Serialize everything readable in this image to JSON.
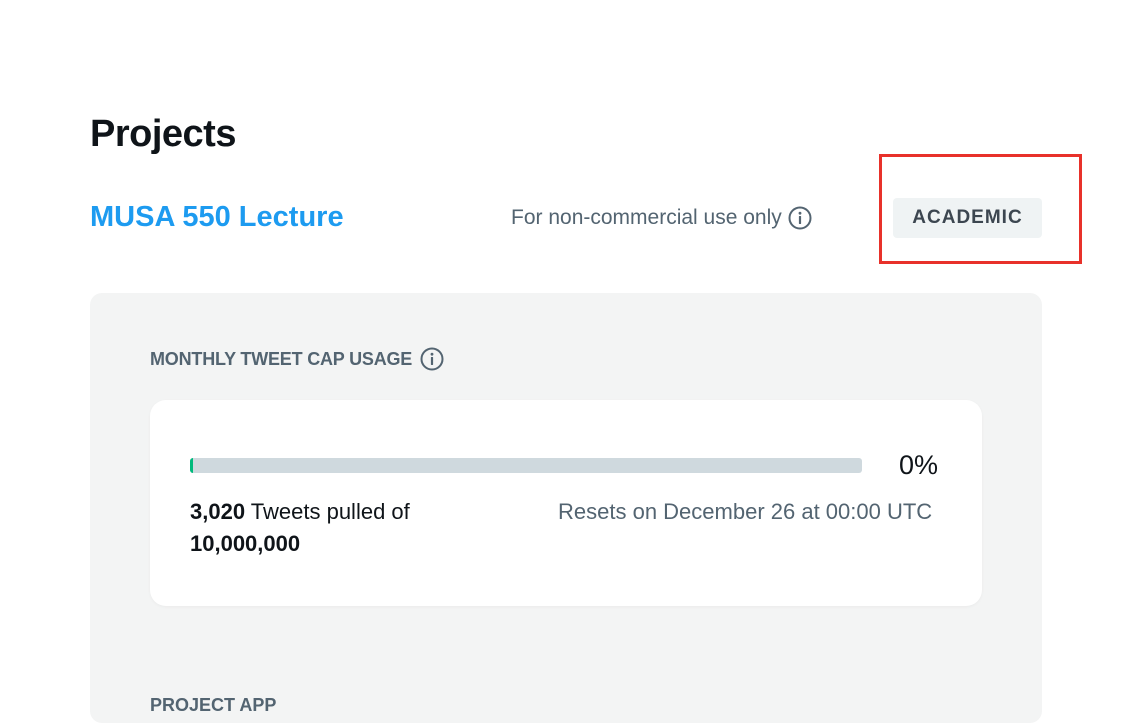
{
  "page": {
    "title": "Projects"
  },
  "project": {
    "name": "MUSA 550 Lecture",
    "usage_note": "For non-commercial use only",
    "badge": "ACADEMIC"
  },
  "tweet_cap": {
    "heading": "MONTHLY TWEET CAP USAGE",
    "percent_label": "0%",
    "progress_fraction": 0.0003,
    "pulled_count": "3,020",
    "pulled_text": " Tweets pulled of ",
    "cap_total": "10,000,000",
    "reset_text": "Resets on December 26 at 00:00 UTC"
  },
  "next_section": {
    "heading": "PROJECT APP"
  },
  "icons": {
    "usage_note_icon": "info-icon",
    "heading_icon": "info-icon"
  },
  "colors": {
    "accent": "#1d9bf0",
    "progress_fill": "#00ba7c",
    "highlight_border": "#e8312a",
    "badge_bg": "#eff3f4",
    "panel_bg": "#f3f4f4"
  }
}
